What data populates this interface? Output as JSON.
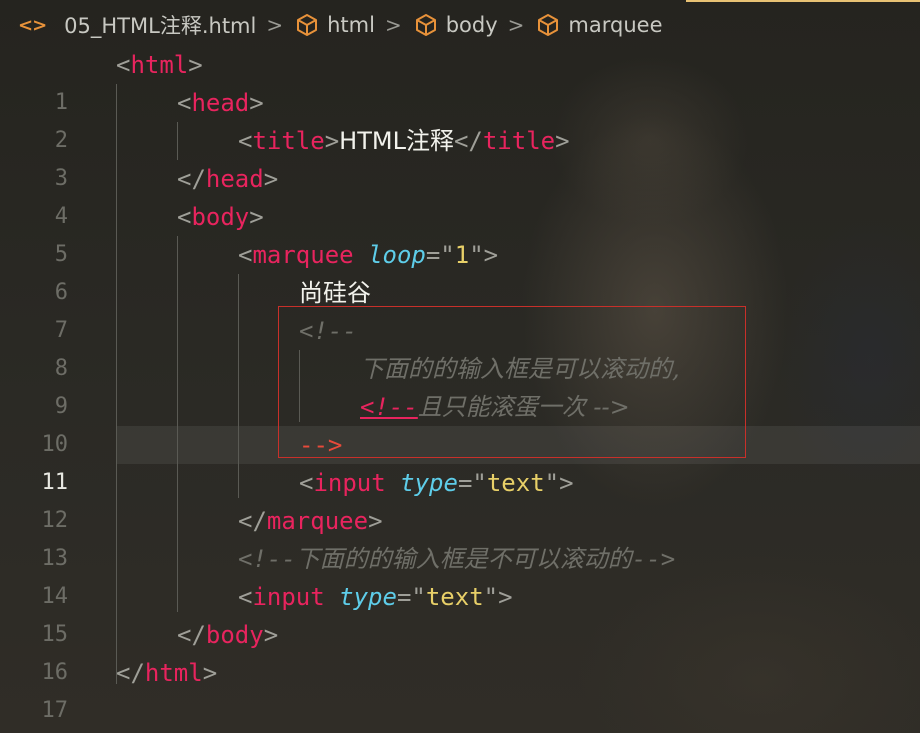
{
  "breadcrumb": {
    "file_icon": "code-brackets-icon",
    "file": "05_HTML注释.html",
    "items": [
      "html",
      "body",
      "marquee"
    ],
    "separator": ">"
  },
  "editor": {
    "active_line": 11,
    "line_numbers": [
      "1",
      "2",
      "3",
      "4",
      "5",
      "6",
      "7",
      "8",
      "9",
      "10",
      "11",
      "12",
      "13",
      "14",
      "15",
      "16",
      "17"
    ],
    "code": {
      "l1_tag": "html",
      "l2_tag": "head",
      "l3_tag": "title",
      "l3_text": "HTML注释",
      "l4_tag": "head",
      "l5_tag": "body",
      "l6_tag": "marquee",
      "l6_attr": "loop",
      "l6_value": "1",
      "l7_text": "尚硅谷",
      "l8_comment": "<!--",
      "l9_comment": "下面的的输入框是可以滚动的,",
      "l10_open": "<!--",
      "l10_text": "且只能滚蛋一次 -->",
      "l11_close": "-->",
      "l12_tag": "input",
      "l12_attr": "type",
      "l12_value": "text",
      "l13_tag": "marquee",
      "l14_open": "<!--",
      "l14_text": "下面的的输入框是不可以滚动的",
      "l14_close": "-->",
      "l15_tag": "input",
      "l15_attr": "type",
      "l15_value": "text",
      "l16_tag": "body",
      "l17_tag": "html"
    }
  },
  "colors": {
    "tag": "#e8245e",
    "attribute": "#5ecde9",
    "string": "#e8d068",
    "comment": "#6f6f68",
    "punctuation": "#9f9f98",
    "icon_accent": "#e8923a",
    "highlight_border": "#c8302a"
  }
}
